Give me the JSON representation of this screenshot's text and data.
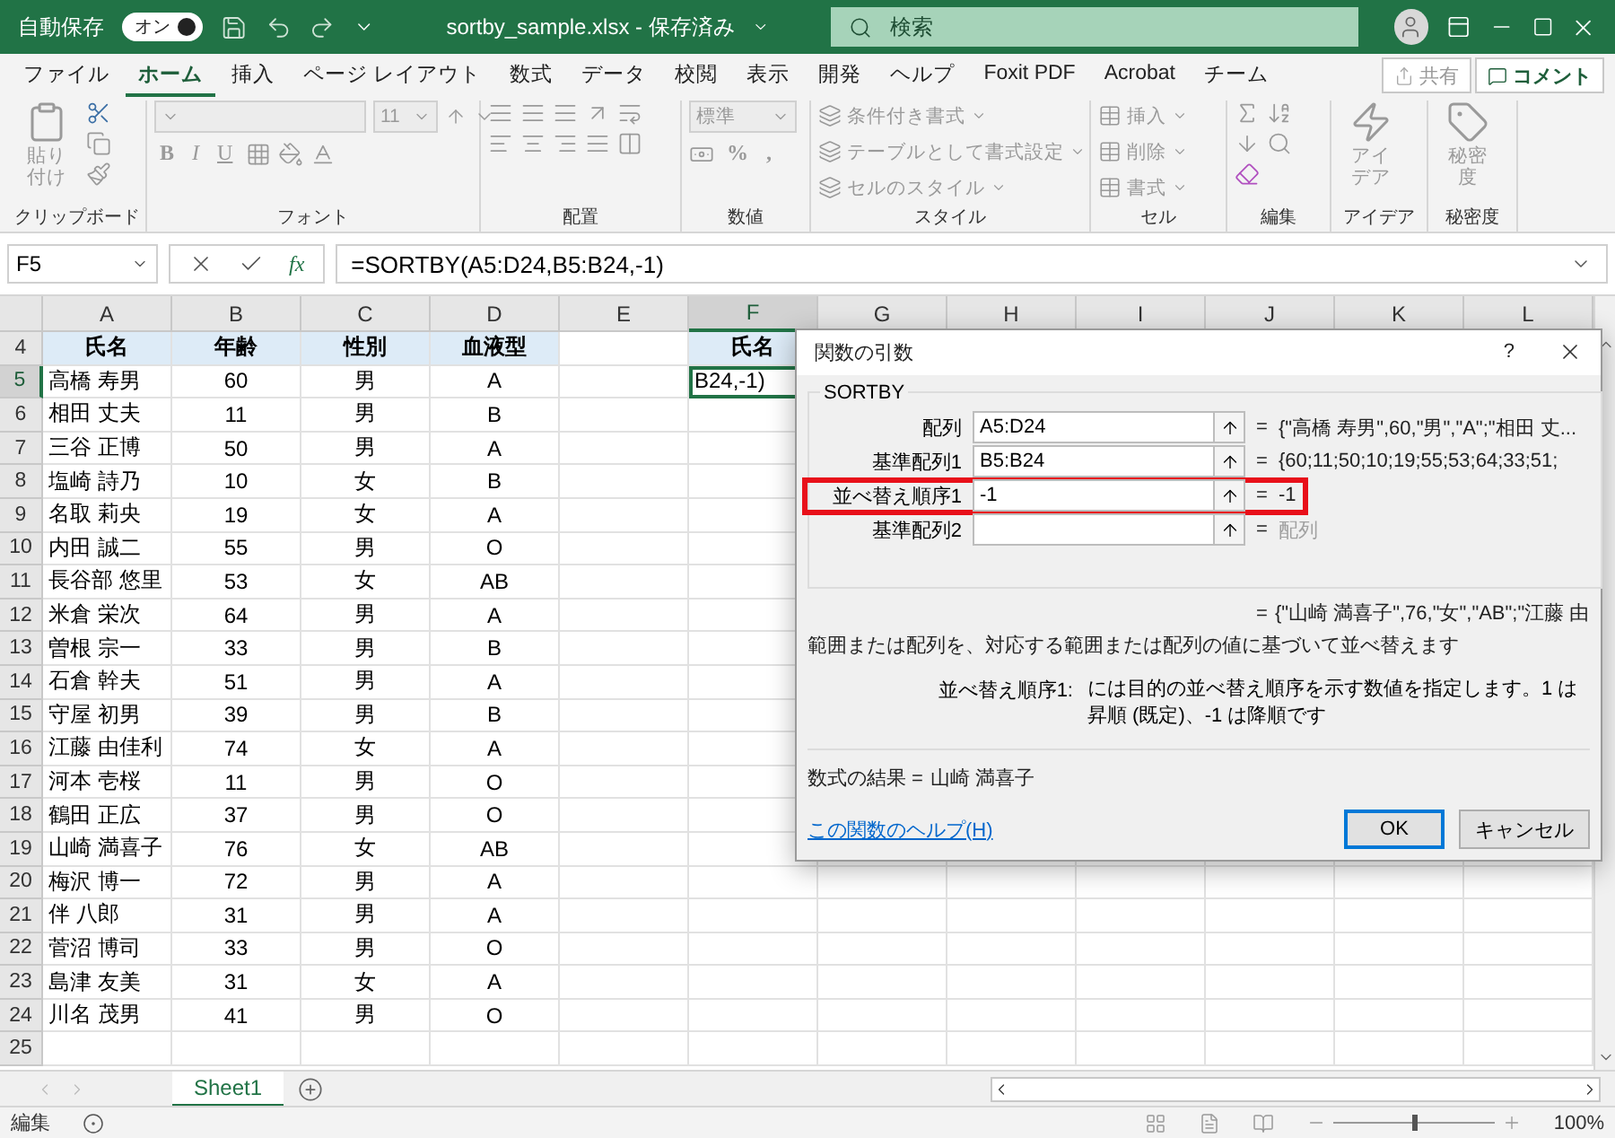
{
  "title_bar": {
    "autosave_label": "自動保存",
    "autosave_toggle": {
      "label": "オン",
      "on": true
    },
    "file_title": "sortby_sample.xlsx - 保存済み",
    "search": {
      "placeholder": "検索"
    }
  },
  "menu_tabs": [
    {
      "label": "ファイル",
      "selected": false
    },
    {
      "label": "ホーム",
      "selected": true
    },
    {
      "label": "挿入",
      "selected": false
    },
    {
      "label": "ページ レイアウト",
      "selected": false
    },
    {
      "label": "数式",
      "selected": false
    },
    {
      "label": "データ",
      "selected": false
    },
    {
      "label": "校閲",
      "selected": false
    },
    {
      "label": "表示",
      "selected": false
    },
    {
      "label": "開発",
      "selected": false
    },
    {
      "label": "ヘルプ",
      "selected": false
    },
    {
      "label": "Foxit PDF",
      "selected": false
    },
    {
      "label": "Acrobat",
      "selected": false
    },
    {
      "label": "チーム",
      "selected": false
    }
  ],
  "share_button": "共有",
  "comment_button": "コメント",
  "ribbon": [
    {
      "kind": "clipboard",
      "label": "クリップボード",
      "paste": "貼り付け"
    },
    {
      "kind": "font",
      "label": "フォント",
      "size": "11",
      "styles": [
        "B",
        "I",
        "U"
      ]
    },
    {
      "kind": "alignment",
      "label": "配置"
    },
    {
      "kind": "number",
      "label": "数値",
      "format": "標準",
      "symbols": [
        "%",
        ","
      ]
    },
    {
      "kind": "styles",
      "label": "スタイル",
      "items": [
        "条件付き書式",
        "テーブルとして書式設定",
        "セルのスタイル"
      ]
    },
    {
      "kind": "cells",
      "label": "セル",
      "items": [
        "挿入",
        "削除",
        "書式"
      ]
    },
    {
      "kind": "editing",
      "label": "編集"
    },
    {
      "kind": "ideas",
      "label": "アイデア",
      "button": "アイデア"
    },
    {
      "kind": "sensitivity",
      "label": "秘密度",
      "button": "秘密度"
    }
  ],
  "formula_bar": {
    "name_box": "F5",
    "function_glyph": "fx",
    "formula": "=SORTBY(A5:D24,B5:B24,-1)"
  },
  "columns": [
    {
      "label": "A",
      "selected": false
    },
    {
      "label": "B",
      "selected": false
    },
    {
      "label": "C",
      "selected": false
    },
    {
      "label": "D",
      "selected": false
    },
    {
      "label": "E",
      "selected": false
    },
    {
      "label": "F",
      "selected": true
    },
    {
      "label": "G",
      "selected": false
    },
    {
      "label": "H",
      "selected": false
    },
    {
      "label": "I",
      "selected": false
    },
    {
      "label": "J",
      "selected": false
    },
    {
      "label": "K",
      "selected": false
    },
    {
      "label": "L",
      "selected": false
    }
  ],
  "rows": [
    {
      "number": "4",
      "selected": false,
      "cells": [
        {
          "text": "氏名",
          "kind": "header"
        },
        {
          "text": "年齢",
          "kind": "header"
        },
        {
          "text": "性別",
          "kind": "header"
        },
        {
          "text": "血液型",
          "kind": "header"
        },
        null,
        {
          "text": "氏名",
          "kind": "header"
        }
      ]
    },
    {
      "number": "5",
      "selected": true,
      "cells": [
        {
          "text": "高橋 寿男",
          "kind": "name"
        },
        {
          "text": "60",
          "kind": "center"
        },
        {
          "text": "男",
          "kind": "center"
        },
        {
          "text": "A",
          "kind": "center"
        },
        null,
        {
          "text": "B24,-1)",
          "kind": "active"
        }
      ]
    },
    {
      "number": "6",
      "selected": false,
      "cells": [
        {
          "text": "相田 丈夫",
          "kind": "name"
        },
        {
          "text": "11",
          "kind": "center"
        },
        {
          "text": "男",
          "kind": "center"
        },
        {
          "text": "B",
          "kind": "center"
        }
      ]
    },
    {
      "number": "7",
      "selected": false,
      "cells": [
        {
          "text": "三谷 正博",
          "kind": "name"
        },
        {
          "text": "50",
          "kind": "center"
        },
        {
          "text": "男",
          "kind": "center"
        },
        {
          "text": "A",
          "kind": "center"
        }
      ]
    },
    {
      "number": "8",
      "selected": false,
      "cells": [
        {
          "text": "塩崎 詩乃",
          "kind": "name"
        },
        {
          "text": "10",
          "kind": "center"
        },
        {
          "text": "女",
          "kind": "center"
        },
        {
          "text": "B",
          "kind": "center"
        }
      ]
    },
    {
      "number": "9",
      "selected": false,
      "cells": [
        {
          "text": "名取 莉央",
          "kind": "name"
        },
        {
          "text": "19",
          "kind": "center"
        },
        {
          "text": "女",
          "kind": "center"
        },
        {
          "text": "A",
          "kind": "center"
        }
      ]
    },
    {
      "number": "10",
      "selected": false,
      "cells": [
        {
          "text": "内田 誠二",
          "kind": "name"
        },
        {
          "text": "55",
          "kind": "center"
        },
        {
          "text": "男",
          "kind": "center"
        },
        {
          "text": "O",
          "kind": "center"
        }
      ]
    },
    {
      "number": "11",
      "selected": false,
      "cells": [
        {
          "text": "長谷部 悠里",
          "kind": "name"
        },
        {
          "text": "53",
          "kind": "center"
        },
        {
          "text": "女",
          "kind": "center"
        },
        {
          "text": "AB",
          "kind": "center"
        }
      ]
    },
    {
      "number": "12",
      "selected": false,
      "cells": [
        {
          "text": "米倉 栄次",
          "kind": "name"
        },
        {
          "text": "64",
          "kind": "center"
        },
        {
          "text": "男",
          "kind": "center"
        },
        {
          "text": "A",
          "kind": "center"
        }
      ]
    },
    {
      "number": "13",
      "selected": false,
      "cells": [
        {
          "text": "曽根 宗一",
          "kind": "name"
        },
        {
          "text": "33",
          "kind": "center"
        },
        {
          "text": "男",
          "kind": "center"
        },
        {
          "text": "B",
          "kind": "center"
        }
      ]
    },
    {
      "number": "14",
      "selected": false,
      "cells": [
        {
          "text": "石倉 幹夫",
          "kind": "name"
        },
        {
          "text": "51",
          "kind": "center"
        },
        {
          "text": "男",
          "kind": "center"
        },
        {
          "text": "A",
          "kind": "center"
        }
      ]
    },
    {
      "number": "15",
      "selected": false,
      "cells": [
        {
          "text": "守屋 初男",
          "kind": "name"
        },
        {
          "text": "39",
          "kind": "center"
        },
        {
          "text": "男",
          "kind": "center"
        },
        {
          "text": "B",
          "kind": "center"
        }
      ]
    },
    {
      "number": "16",
      "selected": false,
      "cells": [
        {
          "text": "江藤 由佳利",
          "kind": "name"
        },
        {
          "text": "74",
          "kind": "center"
        },
        {
          "text": "女",
          "kind": "center"
        },
        {
          "text": "A",
          "kind": "center"
        }
      ]
    },
    {
      "number": "17",
      "selected": false,
      "cells": [
        {
          "text": "河本 壱桜",
          "kind": "name"
        },
        {
          "text": "11",
          "kind": "center"
        },
        {
          "text": "男",
          "kind": "center"
        },
        {
          "text": "O",
          "kind": "center"
        }
      ]
    },
    {
      "number": "18",
      "selected": false,
      "cells": [
        {
          "text": "鶴田 正広",
          "kind": "name"
        },
        {
          "text": "37",
          "kind": "center"
        },
        {
          "text": "男",
          "kind": "center"
        },
        {
          "text": "O",
          "kind": "center"
        }
      ]
    },
    {
      "number": "19",
      "selected": false,
      "cells": [
        {
          "text": "山崎 満喜子",
          "kind": "name"
        },
        {
          "text": "76",
          "kind": "center"
        },
        {
          "text": "女",
          "kind": "center"
        },
        {
          "text": "AB",
          "kind": "center"
        }
      ]
    },
    {
      "number": "20",
      "selected": false,
      "cells": [
        {
          "text": "梅沢 博一",
          "kind": "name"
        },
        {
          "text": "72",
          "kind": "center"
        },
        {
          "text": "男",
          "kind": "center"
        },
        {
          "text": "A",
          "kind": "center"
        }
      ]
    },
    {
      "number": "21",
      "selected": false,
      "cells": [
        {
          "text": "伴 八郎",
          "kind": "name"
        },
        {
          "text": "31",
          "kind": "center"
        },
        {
          "text": "男",
          "kind": "center"
        },
        {
          "text": "A",
          "kind": "center"
        }
      ]
    },
    {
      "number": "22",
      "selected": false,
      "cells": [
        {
          "text": "菅沼 博司",
          "kind": "name"
        },
        {
          "text": "33",
          "kind": "center"
        },
        {
          "text": "男",
          "kind": "center"
        },
        {
          "text": "O",
          "kind": "center"
        }
      ]
    },
    {
      "number": "23",
      "selected": false,
      "cells": [
        {
          "text": "島津 友美",
          "kind": "name"
        },
        {
          "text": "31",
          "kind": "center"
        },
        {
          "text": "女",
          "kind": "center"
        },
        {
          "text": "A",
          "kind": "center"
        }
      ]
    },
    {
      "number": "24",
      "selected": false,
      "cells": [
        {
          "text": "川名 茂男",
          "kind": "name"
        },
        {
          "text": "41",
          "kind": "center"
        },
        {
          "text": "男",
          "kind": "center"
        },
        {
          "text": "O",
          "kind": "center"
        }
      ]
    },
    {
      "number": "25",
      "selected": false,
      "cells": []
    }
  ],
  "sheet_tabs": [
    {
      "label": "Sheet1",
      "selected": true
    }
  ],
  "status_bar": {
    "mode": "編集",
    "zoom": {
      "level": 0.5,
      "label": "100%"
    }
  },
  "dialog": {
    "title": "関数の引数",
    "help_glyph": "?",
    "function_name": "SORTBY",
    "arguments": [
      {
        "label": "配列",
        "value": "A5:D24",
        "eq": "=",
        "result": "{\"高橋 寿男\",60,\"男\",\"A\";\"相田 丈...",
        "result_greyed": false,
        "highlighted": false
      },
      {
        "label": "基準配列1",
        "value": "B5:B24",
        "eq": "=",
        "result": "{60;11;50;10;19;55;53;64;33;51;",
        "result_greyed": false,
        "highlighted": false
      },
      {
        "label": "並べ替え順序1",
        "value": "-1",
        "eq": "=",
        "result": "-1",
        "result_greyed": false,
        "highlighted": true
      },
      {
        "label": "基準配列2",
        "eq": "=",
        "result": "配列",
        "result_greyed": true,
        "highlighted": false
      }
    ],
    "overall": {
      "eq": "=",
      "value": "{\"山崎 満喜子\",76,\"女\",\"AB\";\"江藤 由"
    },
    "description": "範囲または配列を、対応する範囲または配列の値に基づいて並べ替えます",
    "arg_help": {
      "label": "並べ替え順序1:",
      "text": "には目的の並べ替え順序を示す数値を指定します。1 は昇順 (既定)、-1 は降順です"
    },
    "formula_result": {
      "label": "数式の結果 =",
      "value": "山崎 満喜子"
    },
    "help_link": "この関数のヘルプ(H)",
    "buttons": [
      {
        "label": "OK",
        "default": true
      },
      {
        "label": "キャンセル",
        "default": false
      }
    ]
  }
}
